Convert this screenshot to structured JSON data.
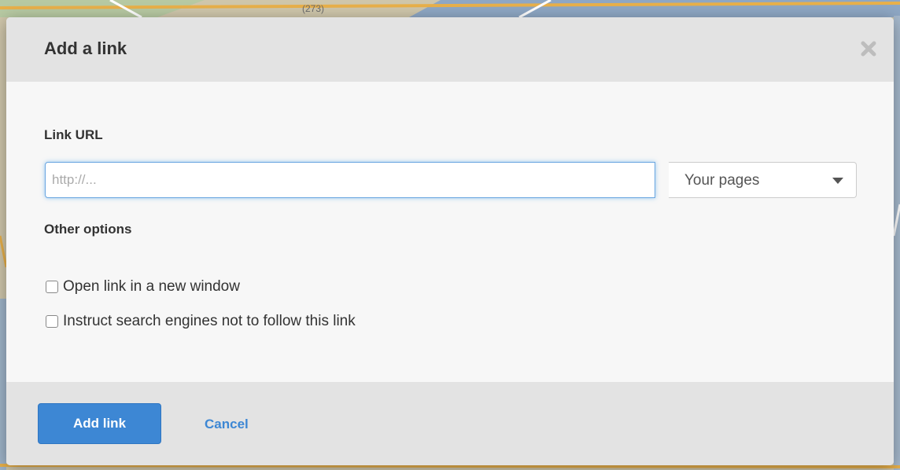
{
  "background": {
    "map_label": "(273)"
  },
  "dialog": {
    "title": "Add a link",
    "close_icon": "close-icon",
    "link_url_label": "Link URL",
    "url_input": {
      "value": "",
      "placeholder": "http://..."
    },
    "pages_select": {
      "selected": "Your pages",
      "icon": "caret-down-icon"
    },
    "other_options_label": "Other options",
    "options": [
      {
        "label": "Open link in a new window",
        "checked": false
      },
      {
        "label": "Instruct search engines not to follow this link",
        "checked": false
      }
    ],
    "add_button_label": "Add link",
    "cancel_label": "Cancel"
  },
  "colors": {
    "accent": "#3d87d4",
    "header_bg": "#e3e3e3",
    "body_bg": "#f7f7f7"
  }
}
